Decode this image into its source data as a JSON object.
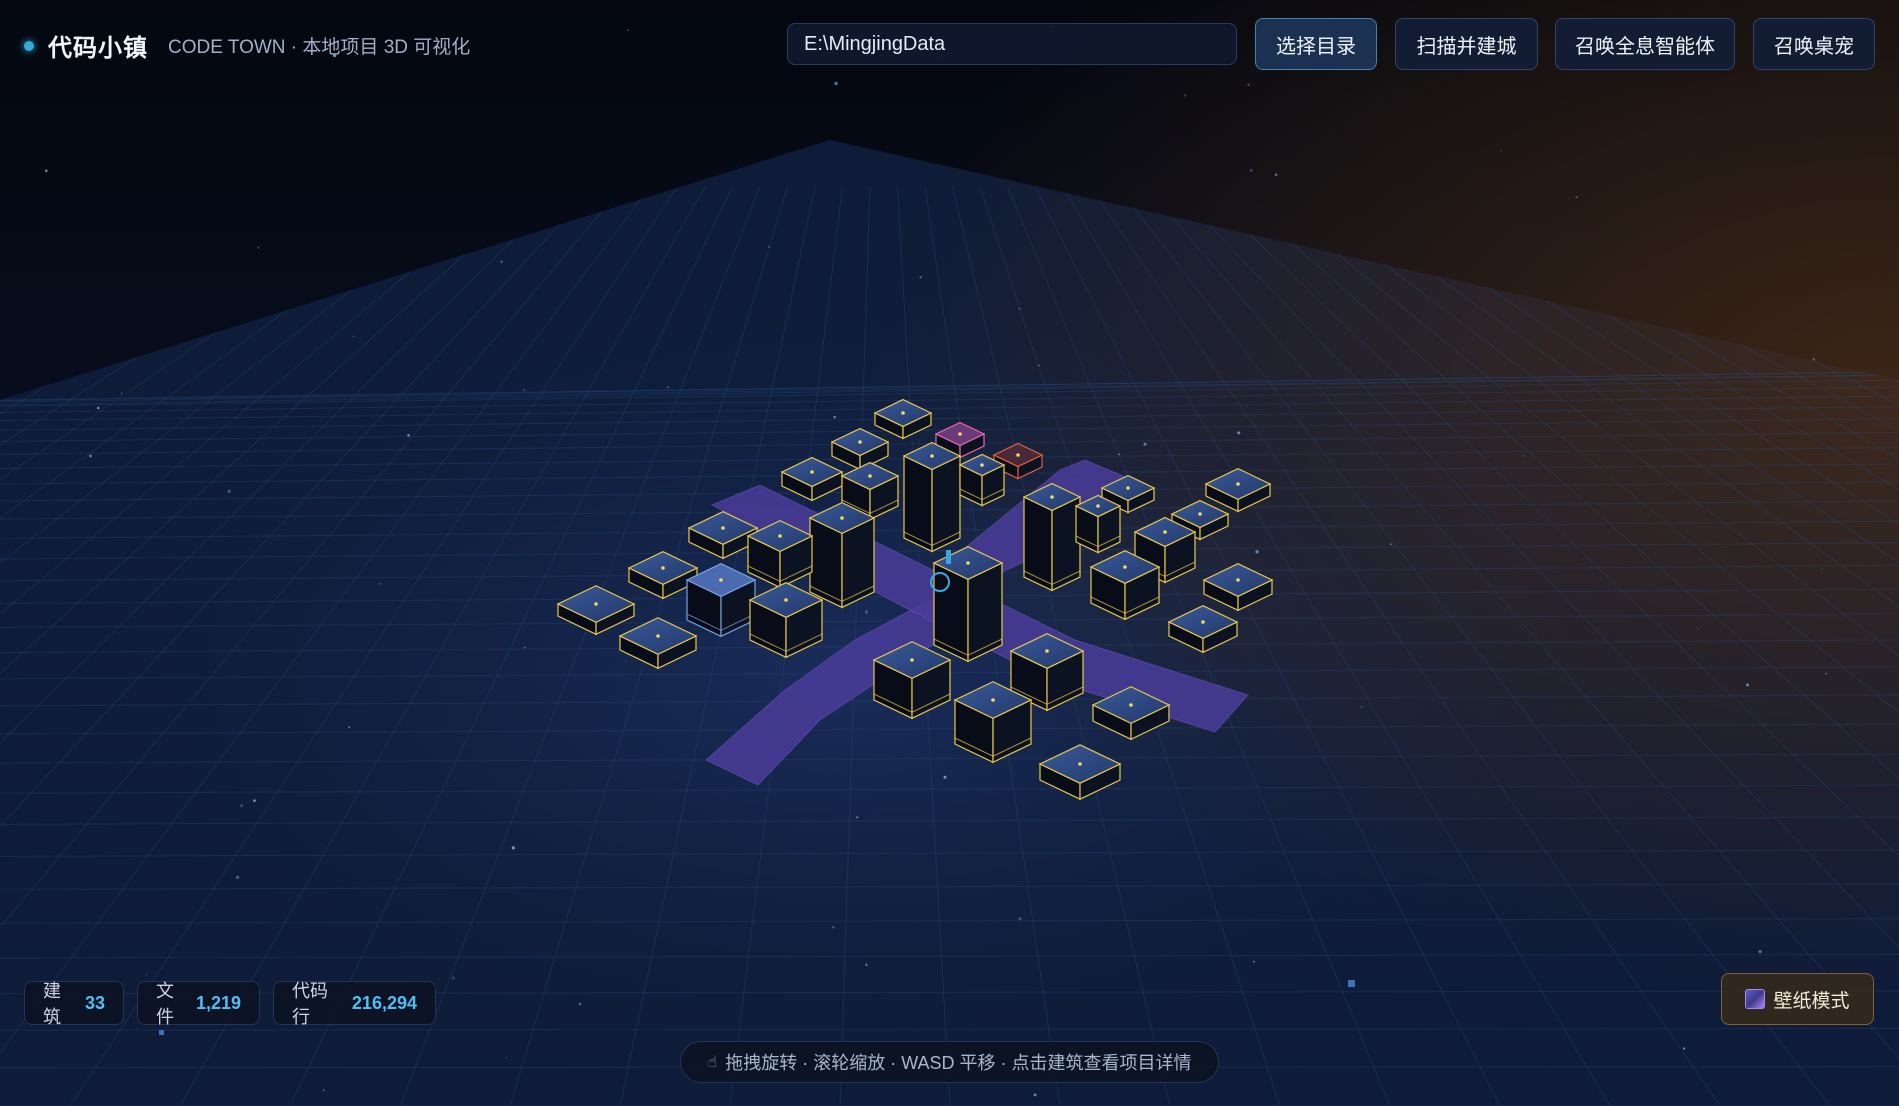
{
  "header": {
    "title": "代码小镇",
    "subtitle": "CODE TOWN · 本地项目 3D 可视化",
    "path_value": "E:\\MingjingData",
    "buttons": {
      "select_dir": "选择目录",
      "scan_build": "扫描并建城",
      "summon_agent": "召唤全息智能体",
      "summon_pet": "召唤桌宠"
    }
  },
  "stats": {
    "buildings_label": "建筑",
    "buildings_value": "33",
    "files_label": "文件",
    "files_value": "1,219",
    "lines_label": "代码行",
    "lines_value": "216,294"
  },
  "hint": {
    "text": "拖拽旋转 · 滚轮缩放 · WASD 平移 · 点击建筑查看项目详情"
  },
  "wallpaper": {
    "label": "壁纸模式"
  },
  "colors": {
    "accent": "#52bdf0",
    "building_edge": "#e8c84a",
    "road": "#4a3c9a",
    "background": "#050a16",
    "warm_glow": "#3a2412"
  }
}
